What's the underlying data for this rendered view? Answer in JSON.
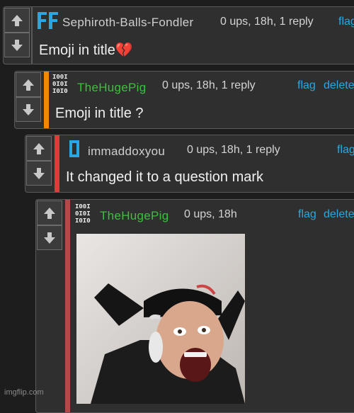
{
  "comments": [
    {
      "username": "Sephiroth-Balls-Fondler",
      "username_color": "#cfcfcf",
      "meta": "0 ups, 18h, 1 reply",
      "flag": "flag",
      "body": "Emoji in title",
      "body_emoji": "💔",
      "avatar_text": "FF",
      "avatar_color": "#2aa7e0"
    },
    {
      "username": "TheHugePig",
      "username_color": "#3fbf3f",
      "meta": "0 ups, 18h, 1 reply",
      "flag": "flag",
      "delete": "delete",
      "body": "Emoji in title ?",
      "stripe_color": "#f08a00"
    },
    {
      "username": "immaddoxyou",
      "username_color": "#cfcfcf",
      "meta": "0 ups, 18h, 1 reply",
      "flag": "flag",
      "body": "It changed it to a question mark",
      "stripe_color": "#e03a3a",
      "avatar_color": "#2aa7e0"
    },
    {
      "username": "TheHugePig",
      "username_color": "#3fbf3f",
      "meta": "0 ups, 18h",
      "flag": "flag",
      "delete": "delete",
      "stripe_color": "#b34a4a"
    }
  ],
  "watermark": "imgflip.com",
  "icons": {
    "upvote": "arrow-up-icon",
    "downvote": "arrow-down-icon",
    "avatar_binary": "binary-avatar-icon"
  }
}
